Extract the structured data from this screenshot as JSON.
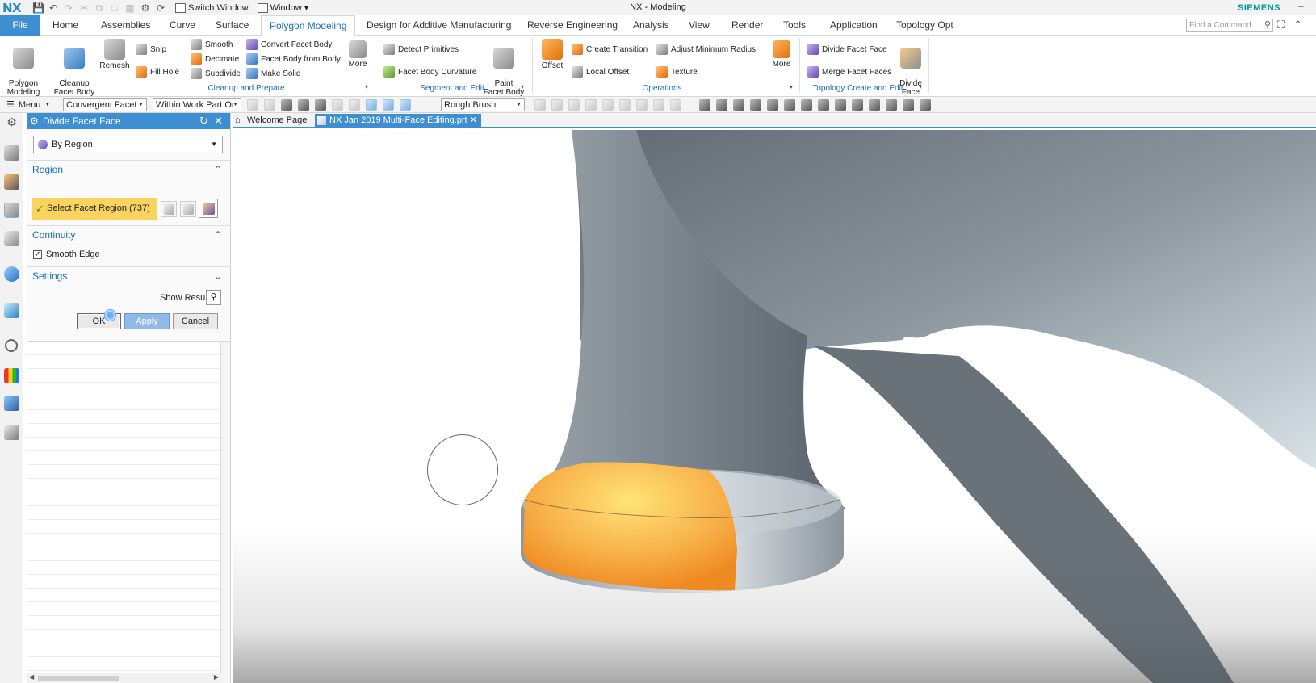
{
  "app": {
    "logo": "NX",
    "window_title": "NX - Modeling",
    "brand": "SIEMENS",
    "qat_switch_window": "Switch Window",
    "qat_window": "Window"
  },
  "tabs": {
    "file": "File",
    "items": [
      "Home",
      "Assemblies",
      "Curve",
      "Surface",
      "Polygon Modeling",
      "Design for Additive Manufacturing",
      "Reverse Engineering",
      "Analysis",
      "View",
      "Render",
      "Tools",
      "Application",
      "Topology Opt"
    ],
    "active": "Polygon Modeling",
    "find_placeholder": "Find a Command"
  },
  "ribbon": {
    "polygon_modeling": "Polygon\nModeling",
    "cleanup_facet_body": "Cleanup\nFacet Body",
    "remesh": "Remesh",
    "snip": "Snip",
    "fill_hole": "Fill Hole",
    "smooth": "Smooth",
    "decimate": "Decimate",
    "subdivide": "Subdivide",
    "convert_facet_body": "Convert Facet Body",
    "facet_body_from_body": "Facet Body from Body",
    "make_solid": "Make Solid",
    "more1": "More",
    "group_cleanup": "Cleanup and Prepare",
    "detect_primitives": "Detect Primitives",
    "facet_body_curvature": "Facet Body Curvature",
    "paint_facet_body": "Paint\nFacet Body",
    "group_segment": "Segment and Edit",
    "offset": "Offset",
    "create_transition": "Create Transition",
    "local_offset": "Local Offset",
    "adjust_minimum_radius": "Adjust Minimum Radius",
    "texture": "Texture",
    "more2": "More",
    "group_operations": "Operations",
    "divide_facet_face": "Divide Facet Face",
    "merge_facet_faces": "Merge Facet Faces",
    "divide_face": "Divide\nFace",
    "group_topology": "Topology Create and Edit"
  },
  "filterbar": {
    "menu": "Menu",
    "type_filter": "Convergent Facet",
    "scope_filter": "Within Work Part Or",
    "brush_filter": "Rough Brush"
  },
  "dialog": {
    "title": "Divide Facet Face",
    "method": "By Region",
    "section_region": "Region",
    "select_region": "Select Facet Region (737)",
    "section_continuity": "Continuity",
    "smooth_edge": "Smooth Edge",
    "smooth_edge_checked": true,
    "section_settings": "Settings",
    "show_result": "Show Result",
    "ok": "OK",
    "apply": "Apply",
    "cancel": "Cancel"
  },
  "docs": {
    "welcome": "Welcome Page",
    "active_part": "NX Jan 2019 Multi-Face Editing.prt"
  },
  "colors": {
    "accent": "#3d8fd1",
    "selection": "#fbd35f",
    "highlight_region": "#f5a23c",
    "model_gray": "#8f9aa3"
  }
}
